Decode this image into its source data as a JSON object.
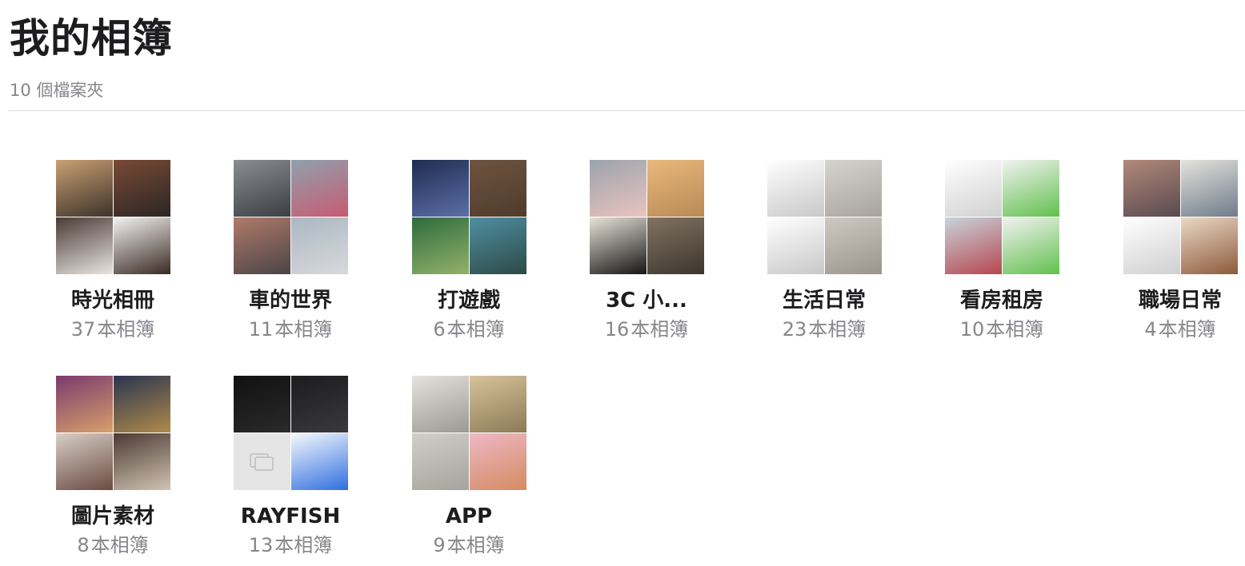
{
  "page": {
    "title": "我的相簿",
    "folder_count": "10 個檔案夾"
  },
  "unit_label": "本相簿",
  "albums": [
    {
      "name": "時光相冊",
      "count": "37",
      "tiles": [
        {
          "icon": "person-photo",
          "colors": [
            "#c9a074",
            "#3d3229"
          ]
        },
        {
          "icon": "restaurant-photo",
          "colors": [
            "#7a4a36",
            "#2a2624"
          ]
        },
        {
          "icon": "poster-photo",
          "colors": [
            "#4a3b36",
            "#e9e4df"
          ]
        },
        {
          "icon": "emoji-screenshot",
          "colors": [
            "#f2f2f2",
            "#3a2a22"
          ]
        }
      ]
    },
    {
      "name": "車的世界",
      "count": "11",
      "tiles": [
        {
          "icon": "steering-wheel-photo",
          "colors": [
            "#8a8d91",
            "#3b3e42"
          ]
        },
        {
          "icon": "pink-car-photo",
          "colors": [
            "#8fa1ad",
            "#c75b73"
          ]
        },
        {
          "icon": "car-wheel-photo",
          "colors": [
            "#b07a6a",
            "#4b4447"
          ]
        },
        {
          "icon": "white-suv-photo",
          "colors": [
            "#aab7c2",
            "#d9d9dc"
          ]
        }
      ]
    },
    {
      "name": "打遊戲",
      "count": "6",
      "tiles": [
        {
          "icon": "game-lobby-screenshot",
          "colors": [
            "#1f2c4f",
            "#5b6fa8"
          ]
        },
        {
          "icon": "brown-fabric-photo",
          "colors": [
            "#6e5440",
            "#4f3b2c"
          ]
        },
        {
          "icon": "game-map-screenshot",
          "colors": [
            "#2d6b3d",
            "#93b26a"
          ]
        },
        {
          "icon": "game-cliff-screenshot",
          "colors": [
            "#4f8fa3",
            "#2d4a45"
          ]
        }
      ]
    },
    {
      "name": "3C 小...",
      "count": "16",
      "tiles": [
        {
          "icon": "pink-phone-photo",
          "colors": [
            "#9ca3ac",
            "#e9c4bf"
          ]
        },
        {
          "icon": "phone-box-photo",
          "colors": [
            "#e8b87c",
            "#b98a57"
          ]
        },
        {
          "icon": "one-piece-case-photo",
          "colors": [
            "#e7e3d8",
            "#151515"
          ]
        },
        {
          "icon": "dark-phone-photo",
          "colors": [
            "#807363",
            "#3d352c"
          ]
        }
      ]
    },
    {
      "name": "生活日常",
      "count": "23",
      "tiles": [
        {
          "icon": "chat-screenshot",
          "colors": [
            "#ffffff",
            "#c8c8c8"
          ]
        },
        {
          "icon": "lined-paper-photo",
          "colors": [
            "#d6d4cf",
            "#a7a49d"
          ]
        },
        {
          "icon": "chat-screenshot",
          "colors": [
            "#ffffff",
            "#c8c8c8"
          ]
        },
        {
          "icon": "receipt-photo",
          "colors": [
            "#cfcac1",
            "#9a958c"
          ]
        }
      ]
    },
    {
      "name": "看房租房",
      "count": "10",
      "tiles": [
        {
          "icon": "document-screenshot",
          "colors": [
            "#ffffff",
            "#d0d0d0"
          ]
        },
        {
          "icon": "chat-screenshot",
          "colors": [
            "#f2f2f2",
            "#62c04e"
          ]
        },
        {
          "icon": "building-photo",
          "colors": [
            "#c9d4dc",
            "#b5474f"
          ]
        },
        {
          "icon": "chat-screenshot",
          "colors": [
            "#f2f2f2",
            "#62c04e"
          ]
        }
      ]
    },
    {
      "name": "職場日常",
      "count": "4",
      "tiles": [
        {
          "icon": "office-meal-photo",
          "colors": [
            "#b18a7a",
            "#5a4a50"
          ]
        },
        {
          "icon": "office-room-photo",
          "colors": [
            "#e5e3dd",
            "#6f7c8a"
          ]
        },
        {
          "icon": "chat-screenshot",
          "colors": [
            "#ffffff",
            "#cfcfcf"
          ]
        },
        {
          "icon": "wooden-door-photo",
          "colors": [
            "#ead9c6",
            "#8e5a3c"
          ]
        }
      ]
    },
    {
      "name": "圖片素材",
      "count": "8",
      "tiles": [
        {
          "icon": "doge-card-image",
          "colors": [
            "#7a3a6e",
            "#d7a06a"
          ]
        },
        {
          "icon": "anime-battle-image",
          "colors": [
            "#2a3550",
            "#b08a4a"
          ]
        },
        {
          "icon": "anime-character-image",
          "colors": [
            "#d8cfc6",
            "#6b4b43"
          ]
        },
        {
          "icon": "anime-soldier-image",
          "colors": [
            "#4a3a33",
            "#d1c3b3"
          ]
        }
      ]
    },
    {
      "name": "RAYFISH",
      "count": "13",
      "tiles": [
        {
          "icon": "lost-iphone-screenshot",
          "colors": [
            "#111111",
            "#2a2a2a"
          ]
        },
        {
          "icon": "settings-screenshot",
          "colors": [
            "#1c1c1e",
            "#3a3a3c"
          ]
        },
        {
          "icon": "photo-placeholder",
          "colors": [
            "#e5e5e5",
            "#bdbdbd"
          ]
        },
        {
          "icon": "banking-app-screenshot",
          "colors": [
            "#f7f9fc",
            "#2f6fe0"
          ]
        }
      ]
    },
    {
      "name": "APP",
      "count": "9",
      "tiles": [
        {
          "icon": "ceiling-fan-photo",
          "colors": [
            "#e5e3de",
            "#9c9893"
          ]
        },
        {
          "icon": "gold-car-photo",
          "colors": [
            "#d7c39a",
            "#8c7a57"
          ]
        },
        {
          "icon": "book-page-photo",
          "colors": [
            "#d1cfca",
            "#a6a39c"
          ]
        },
        {
          "icon": "pink-perfume-photo",
          "colors": [
            "#eeb8c5",
            "#d48b63"
          ]
        }
      ]
    }
  ]
}
